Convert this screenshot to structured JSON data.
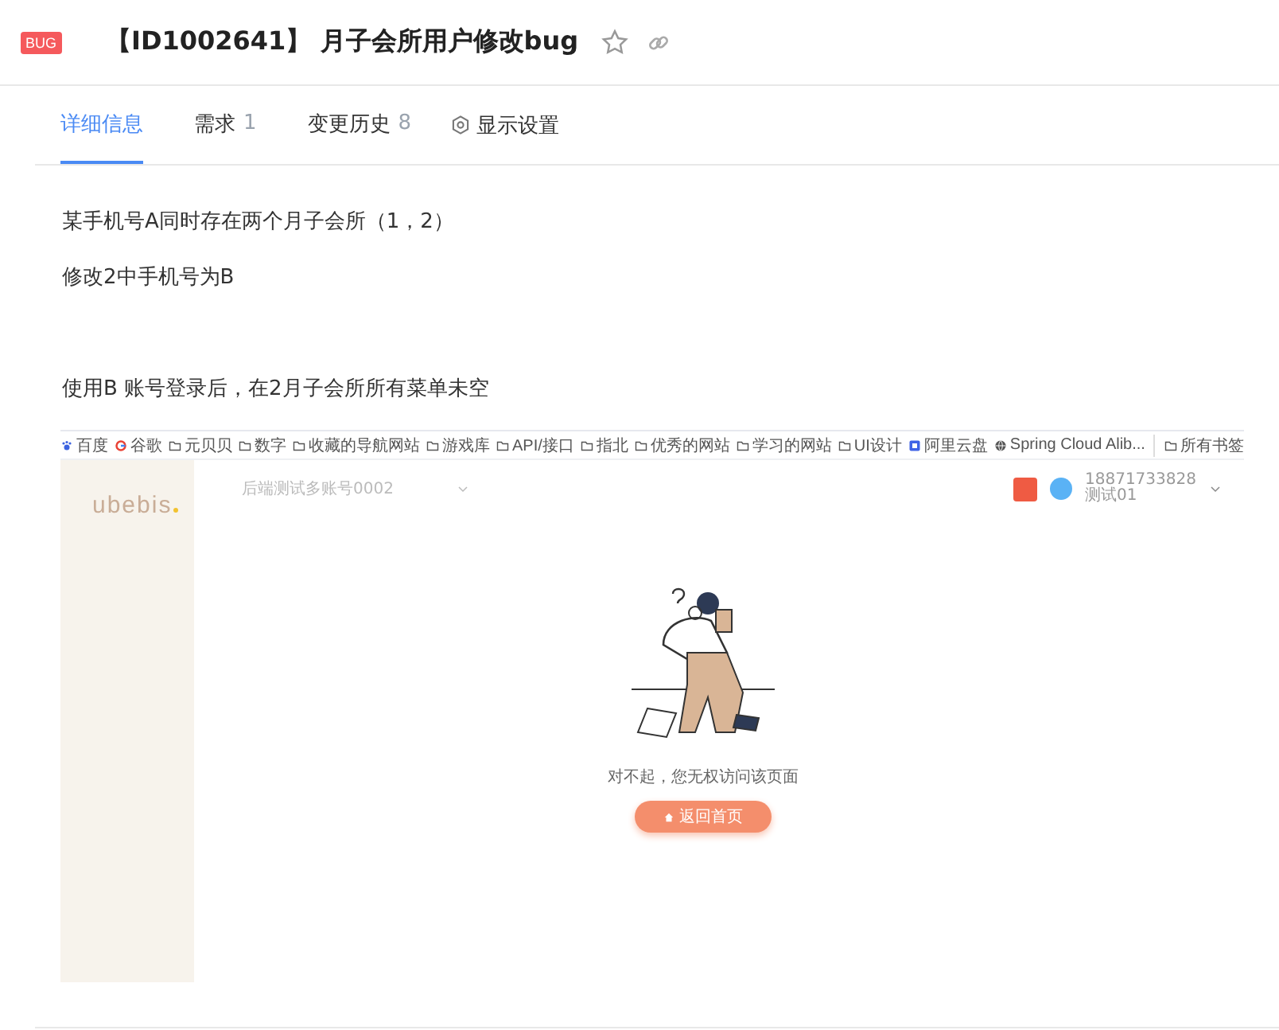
{
  "header": {
    "badge": "BUG",
    "title": "【ID1002641】 月子会所用户修改bug",
    "starred": false
  },
  "tabs": [
    {
      "label": "详细信息",
      "selected": true
    },
    {
      "label": "需求",
      "count": "1",
      "selected": false
    },
    {
      "label": "变更历史",
      "count": "8",
      "selected": false
    }
  ],
  "settings_tab": {
    "label": "显示设置"
  },
  "description": [
    "某手机号A同时存在两个月子会所（1，2）",
    "修改2中手机号为B",
    "使用B 账号登录后，在2月子会所所有菜单未空"
  ],
  "screenshot": {
    "bookmarks": [
      {
        "kind": "paw",
        "label": "百度"
      },
      {
        "kind": "google",
        "label": "谷歌"
      },
      {
        "kind": "folder",
        "label": "元贝贝"
      },
      {
        "kind": "folder",
        "label": "数字"
      },
      {
        "kind": "folder",
        "label": "收藏的导航网站"
      },
      {
        "kind": "folder",
        "label": "游戏库"
      },
      {
        "kind": "folder",
        "label": "API/接口"
      },
      {
        "kind": "folder",
        "label": "指北"
      },
      {
        "kind": "folder",
        "label": "优秀的网站"
      },
      {
        "kind": "folder",
        "label": "学习的网站"
      },
      {
        "kind": "folder",
        "label": "UI设计"
      },
      {
        "kind": "app",
        "label": "阿里云盘"
      },
      {
        "kind": "globe",
        "label": "Spring Cloud Alib..."
      }
    ],
    "all_bookmarks": "所有书签",
    "logo": "ubebis",
    "account_select": "后端测试多账号0002",
    "user_phone": "18871733828",
    "user_role": "测试01",
    "message": "对不起，您无权访问该页面",
    "home_button": "返回首页"
  }
}
